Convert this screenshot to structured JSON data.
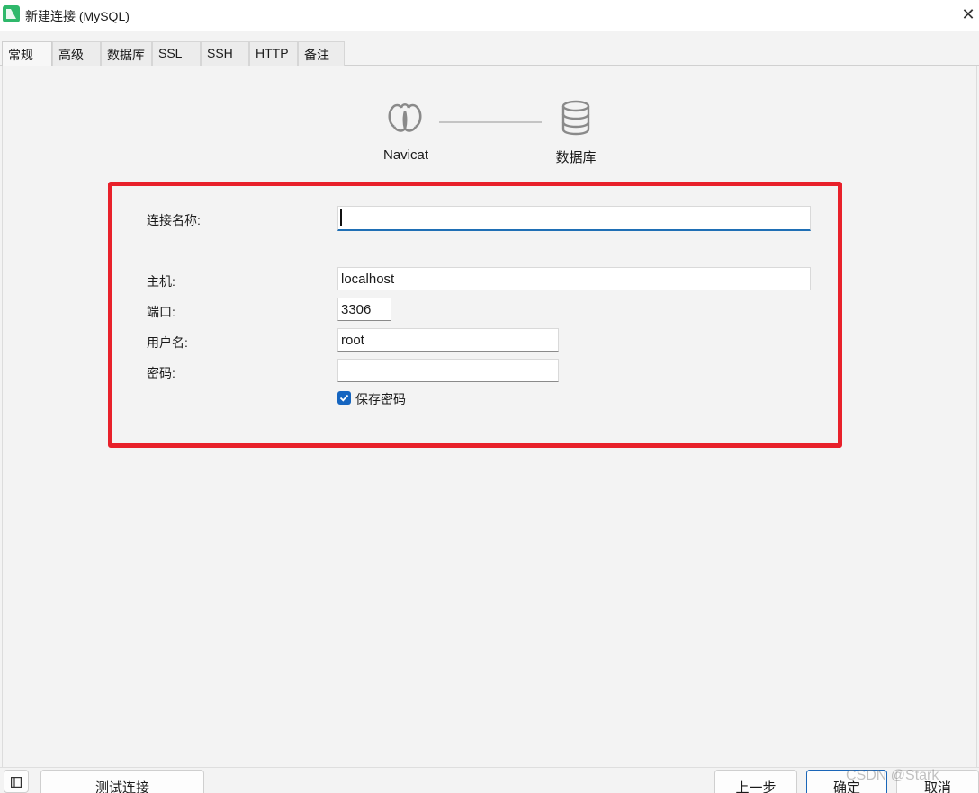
{
  "window": {
    "title": "新建连接 (MySQL)",
    "close_glyph": "✕"
  },
  "tabs": [
    {
      "label": "常规",
      "active": true
    },
    {
      "label": "高级"
    },
    {
      "label": "数据库"
    },
    {
      "label": "SSL"
    },
    {
      "label": "SSH"
    },
    {
      "label": "HTTP"
    },
    {
      "label": "备注"
    }
  ],
  "diagram": {
    "source_label": "Navicat",
    "target_label": "数据库",
    "source_icon": "navicat-logo-icon",
    "target_icon": "database-icon"
  },
  "form": {
    "connection_name": {
      "label": "连接名称:",
      "value": ""
    },
    "host": {
      "label": "主机:",
      "value": "localhost"
    },
    "port": {
      "label": "端口:",
      "value": "3306"
    },
    "username": {
      "label": "用户名:",
      "value": "root"
    },
    "password": {
      "label": "密码:",
      "value": ""
    },
    "save_password": {
      "label": "保存密码",
      "checked": true
    }
  },
  "footer": {
    "test_connection": "测试连接",
    "back": "上一步",
    "ok": "确定",
    "cancel": "取消",
    "watermark": "CSDN @Stark"
  },
  "colors": {
    "highlight": "#e8202a",
    "accent": "#1565c0",
    "app_icon": "#2fb86b"
  }
}
